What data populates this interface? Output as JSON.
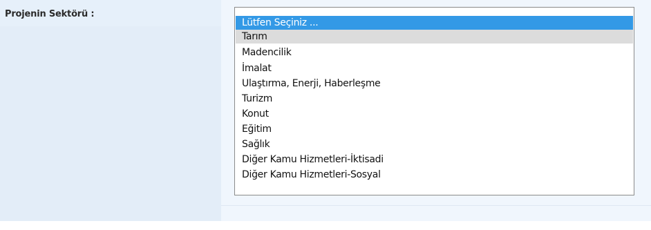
{
  "form": {
    "sector_label": "Projenin Sektörü :"
  },
  "sector_select": {
    "options": [
      "Lütfen Seçiniz ...",
      "Tarım",
      "Madencilik",
      "İmalat",
      "Ulaştırma, Enerji, Haberleşme",
      "Turizm",
      "Konut",
      "Eğitim",
      "Sağlık",
      "Diğer Kamu Hizmetleri-İktisadi",
      "Diğer Kamu Hizmetleri-Sosyal"
    ],
    "highlighted_option": "Lütfen Seçiniz ...",
    "selected_option": "Tarım"
  },
  "colors": {
    "highlight": "#3399e6",
    "selected": "#dcdcdc",
    "left_panel": "#e6f0fa",
    "right_panel": "#f0f6fd"
  }
}
